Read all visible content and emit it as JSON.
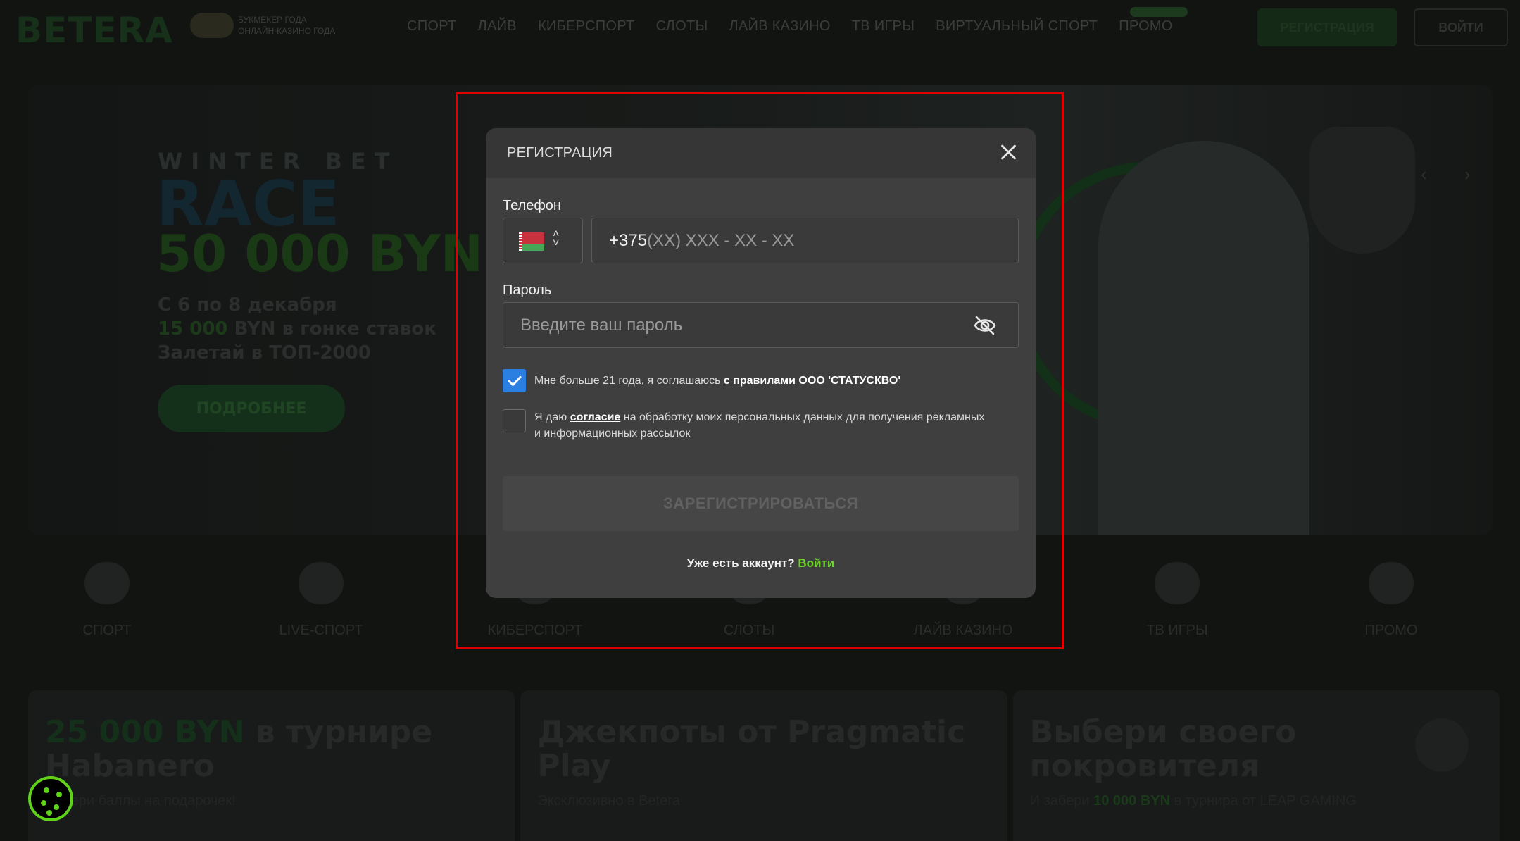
{
  "header": {
    "logo": "BETERA",
    "award_line1": "БУКМЕКЕР ГОДА",
    "award_line2": "ОНЛАЙН-КАЗИНО ГОДА",
    "nav": [
      "СПОРТ",
      "ЛАЙВ",
      "КИБЕРСПОРТ",
      "СЛОТЫ",
      "ЛАЙВ КАЗИНО",
      "ТВ ИГРЫ",
      "ВИРТУАЛЬНЫЙ СПОРТ",
      "ПРОМО"
    ],
    "register_label": "РЕГИСТРАЦИЯ",
    "login_label": "ВОЙТИ"
  },
  "hero": {
    "kicker": "WINTER BET",
    "title": "RACE",
    "amount": "50 000 BYN",
    "line1": "С 6 по 8 декабря",
    "line2_green": "15 000",
    "line2_rest": " BYN в гонке ставок",
    "line3": "Залетай в ТОП-2000",
    "button": "ПОДРОБНЕЕ",
    "prev_arrow": "‹",
    "next_arrow": "›"
  },
  "categories": [
    "СПОРТ",
    "LIVE-СПОРТ",
    "КИБЕРСПОРТ",
    "СЛОТЫ",
    "ЛАЙВ КАЗИНО",
    "ТВ ИГРЫ",
    "ПРОМО"
  ],
  "banners": [
    {
      "title_green": "25 000 BYN",
      "title_rest": " в турнире Habanero",
      "sub": "Собери баллы на подарочек!"
    },
    {
      "title_green": "",
      "title_rest": "Джекпоты от Pragmatic Play",
      "sub": "Эксклюзивно в Betera"
    },
    {
      "title_green": "",
      "title_rest": "Выбери своего покровителя",
      "sub_pre": "И забери ",
      "sub_green": "10 000 BYN",
      "sub_post": " в турнира от LEAP GAMING"
    }
  ],
  "modal": {
    "title": "РЕГИСТРАЦИЯ",
    "phone_label": "Телефон",
    "phone_prefix": "+375",
    "phone_mask": "(XX) XXX - XX - XX",
    "password_label": "Пароль",
    "password_placeholder": "Введите ваш пароль",
    "age_checkbox": {
      "checked": true,
      "text": "Мне больше 21 года, я соглашаюсь ",
      "link": "с правилами ООО 'СТАТУСКВО'"
    },
    "consent_checkbox": {
      "checked": false,
      "text_pre": "Я даю ",
      "link": "согласие",
      "text_post": " на обработку моих персональных данных для получения рекламных и информационных рассылок"
    },
    "submit_label": "ЗАРЕГИСТРИРОВАТЬСЯ",
    "have_account": "Уже есть аккаунт?",
    "login_link": "Войти"
  },
  "colors": {
    "accent_green": "#6ad22a",
    "checkbox_blue": "#2b7fe0",
    "highlight_red": "#e00000"
  }
}
